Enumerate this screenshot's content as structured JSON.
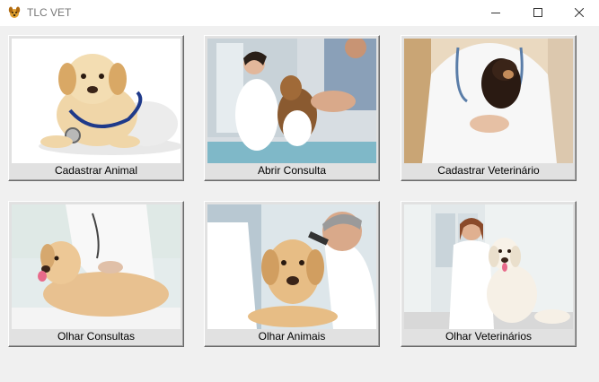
{
  "window": {
    "title": "TLC VET",
    "icon": "dog-app-icon",
    "controls": [
      "minimize-icon",
      "maximize-icon",
      "close-icon"
    ]
  },
  "tiles": [
    {
      "label": "Cadastrar Animal",
      "image": "puppy-with-stethoscope"
    },
    {
      "label": "Abrir Consulta",
      "image": "vet-examining-beagle"
    },
    {
      "label": "Cadastrar Veterinário",
      "image": "vet-holding-puppy"
    },
    {
      "label": "Olhar Consultas",
      "image": "vet-with-labrador"
    },
    {
      "label": "Olhar Animais",
      "image": "vet-otoscope-labrador"
    },
    {
      "label": "Olhar Veterinários",
      "image": "vet-with-golden-retriever"
    }
  ]
}
